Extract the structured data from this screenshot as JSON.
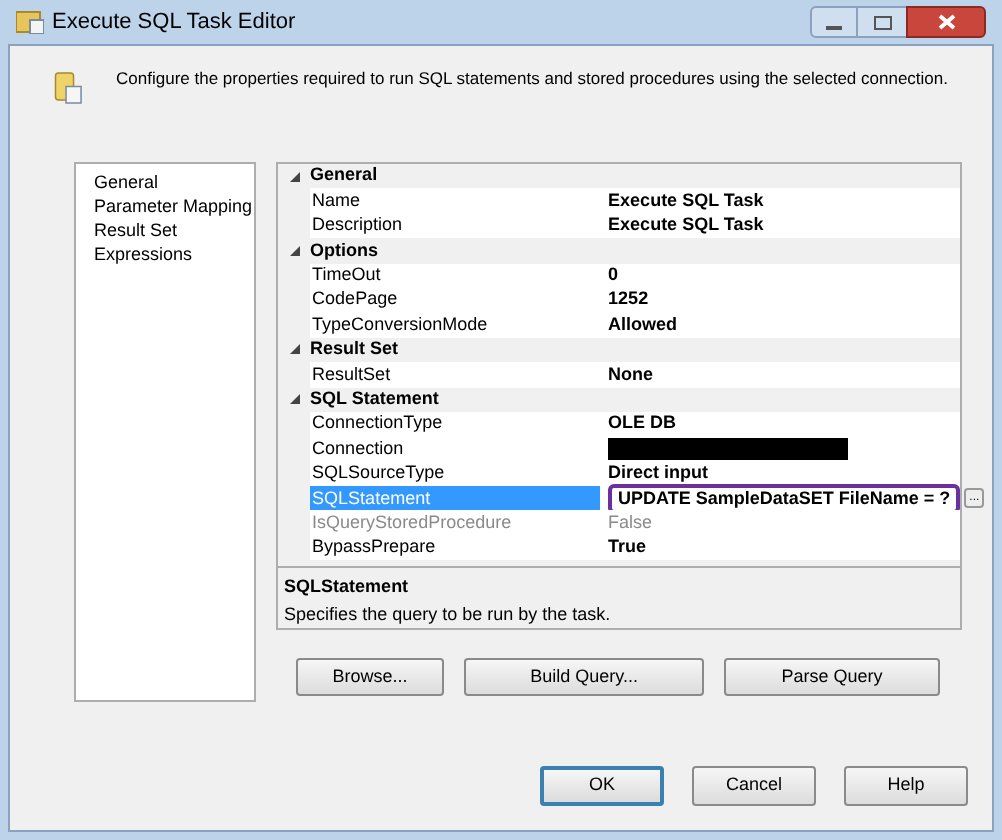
{
  "window": {
    "title": "Execute SQL Task Editor"
  },
  "header": {
    "text": "Configure the properties required to run SQL statements and stored procedures using the selected connection."
  },
  "sidebar": {
    "items": [
      {
        "label": "General",
        "selected": false
      },
      {
        "label": "Parameter Mapping",
        "selected": false
      },
      {
        "label": "Result Set",
        "selected": false
      },
      {
        "label": "Expressions",
        "selected": false
      }
    ]
  },
  "properties": [
    {
      "category": "General",
      "expanded": true,
      "children": [
        {
          "name": "Name",
          "value": "Execute SQL Task",
          "selected": false,
          "disabled": false
        },
        {
          "name": "Description",
          "value": "Execute SQL Task",
          "selected": false,
          "disabled": false
        }
      ]
    },
    {
      "category": "Options",
      "expanded": true,
      "children": [
        {
          "name": "TimeOut",
          "value": "0",
          "selected": false,
          "disabled": false
        },
        {
          "name": "CodePage",
          "value": "1252",
          "selected": false,
          "disabled": false
        },
        {
          "name": "TypeConversionMode",
          "value": "Allowed",
          "selected": false,
          "disabled": false
        }
      ]
    },
    {
      "category": "Result Set",
      "expanded": true,
      "children": [
        {
          "name": "ResultSet",
          "value": "None",
          "selected": false,
          "disabled": false
        }
      ]
    },
    {
      "category": "SQL Statement",
      "expanded": true,
      "children": [
        {
          "name": "ConnectionType",
          "value": "OLE DB",
          "selected": false,
          "disabled": false
        },
        {
          "name": "Connection",
          "kind": "redacted",
          "selected": false,
          "disabled": false
        },
        {
          "name": "SQLSourceType",
          "value": "Direct input",
          "selected": false,
          "disabled": false
        },
        {
          "name": "SQLStatement",
          "value": "UPDATE SampleDataSET FileName = ?",
          "selected": true,
          "disabled": false,
          "highlighted": true,
          "ellipsis": "..."
        },
        {
          "name": "IsQueryStoredProcedure",
          "value": "False",
          "selected": false,
          "disabled": true
        },
        {
          "name": "BypassPrepare",
          "value": "True",
          "selected": false,
          "disabled": false
        }
      ]
    }
  ],
  "description": {
    "title": "SQLStatement",
    "text": "Specifies the query to be run by the task."
  },
  "action_buttons": [
    "Browse...",
    "Build Query...",
    "Parse Query"
  ],
  "dialog_buttons": [
    {
      "label": "OK",
      "default": true
    },
    {
      "label": "Cancel",
      "default": false
    },
    {
      "label": "Help",
      "default": false
    }
  ]
}
